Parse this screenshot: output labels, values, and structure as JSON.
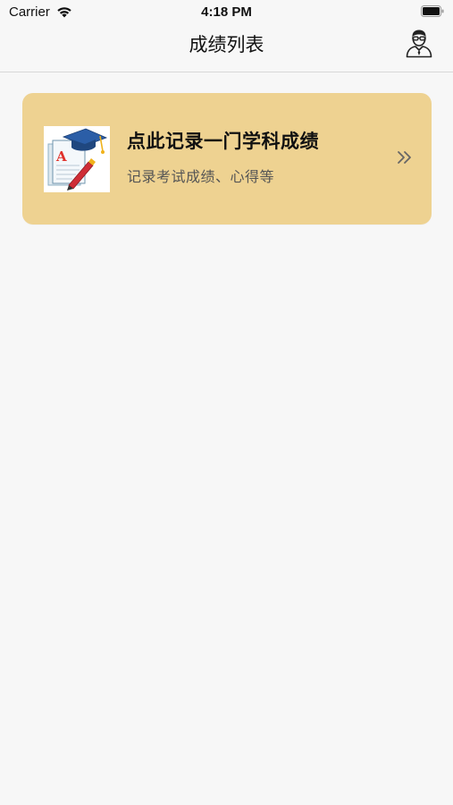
{
  "status_bar": {
    "carrier": "Carrier",
    "time": "4:18 PM"
  },
  "nav": {
    "title": "成绩列表",
    "profile_icon": "user-profile-icon"
  },
  "card": {
    "title": "点此记录一门学科成绩",
    "subtitle": "记录考试成绩、心得等",
    "image_icon": "exam-grade-icon",
    "image_letter": "A",
    "arrow_icon": "double-chevron-right-icon"
  },
  "colors": {
    "background": "#f7f7f7",
    "card": "#eed291",
    "cap": "#2b5ea7",
    "grade": "#e0312b"
  }
}
